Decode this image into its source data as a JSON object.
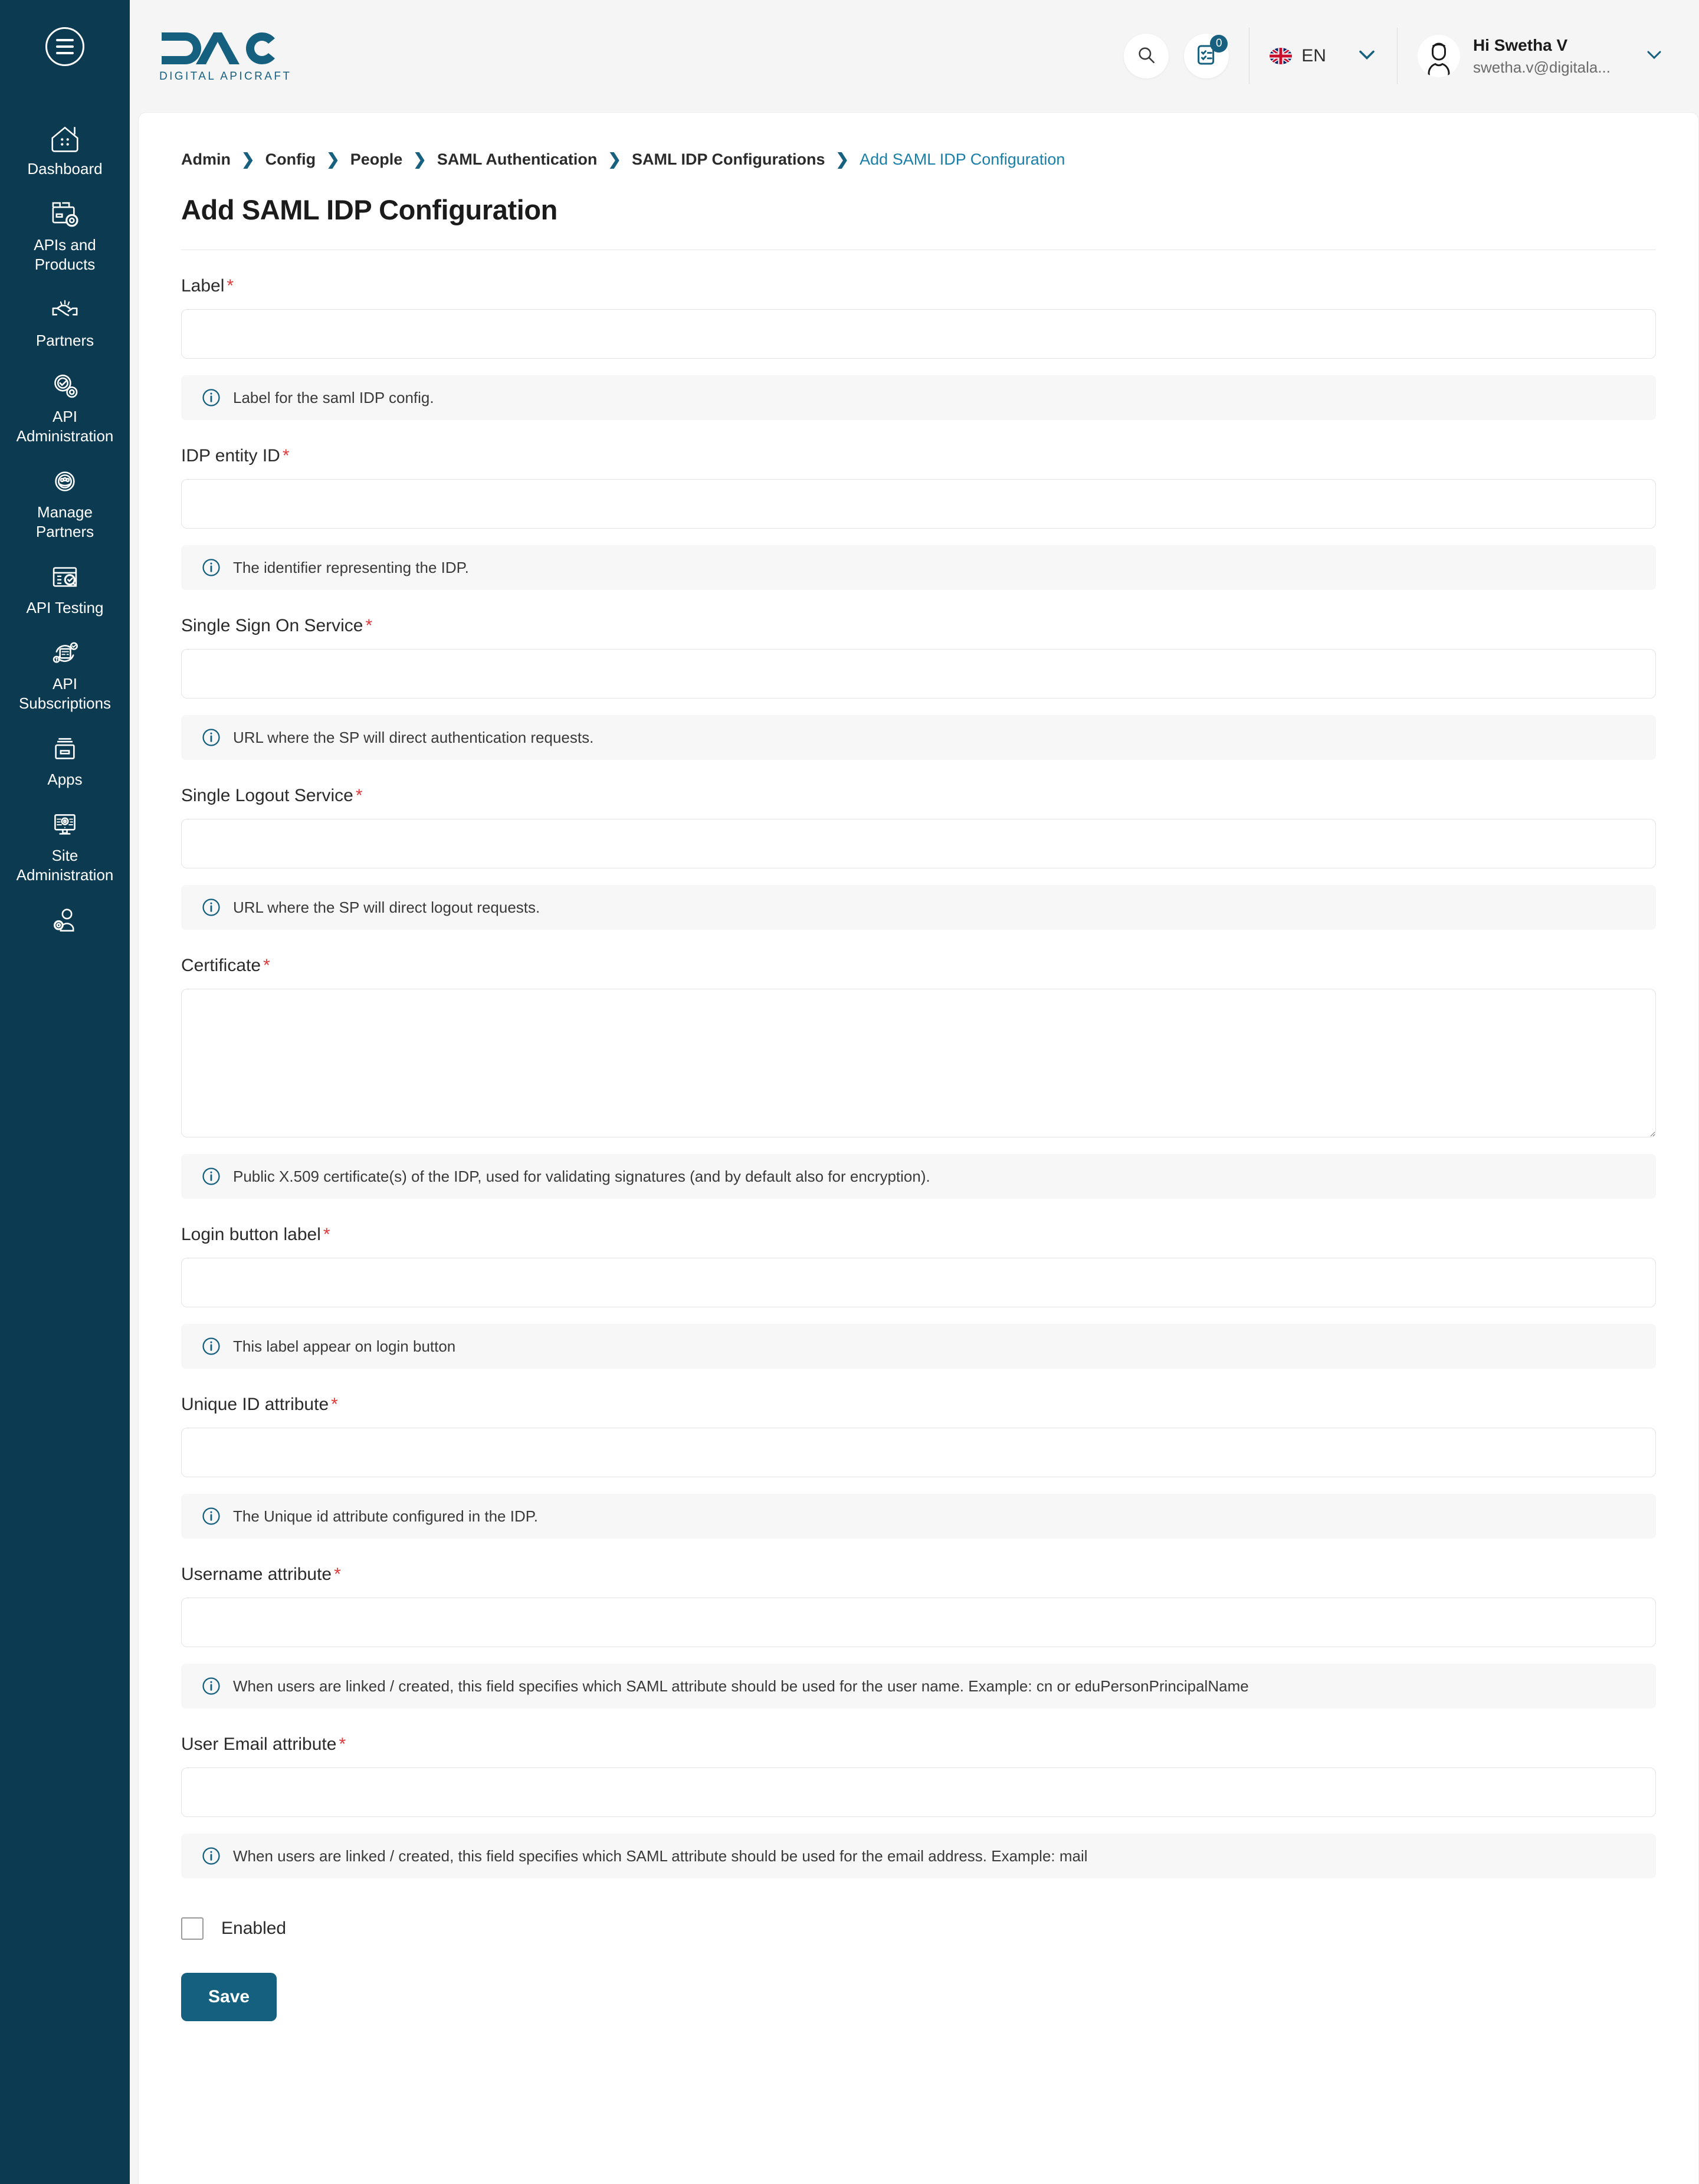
{
  "sidebar": {
    "menu_toggle_label": "menu",
    "items": [
      {
        "label": "Dashboard",
        "icon": "dashboard-home-icon"
      },
      {
        "label": "APIs and Products",
        "icon": "api-products-box-icon"
      },
      {
        "label": "Partners",
        "icon": "handshake-icon"
      },
      {
        "label": "API Administration",
        "icon": "api-admin-gear-icon"
      },
      {
        "label": "Manage Partners",
        "icon": "manage-partners-gear-icon"
      },
      {
        "label": "API Testing",
        "icon": "api-testing-checklist-icon"
      },
      {
        "label": "API Subscriptions",
        "icon": "api-subscriptions-cycle-icon"
      },
      {
        "label": "Apps",
        "icon": "apps-drawer-icon"
      },
      {
        "label": "Site Administration",
        "icon": "site-admin-monitor-icon"
      },
      {
        "label": "",
        "icon": "user-settings-icon"
      }
    ]
  },
  "header": {
    "logo_text": "DAC",
    "logo_tagline": "DIGITAL APICRAFT",
    "search_icon": "search-icon",
    "tasks_icon": "tasks-clipboard-icon",
    "tasks_badge": "0",
    "language_code": "EN",
    "language_flag": "uk-flag-icon",
    "language_chevron": "chevron-down-icon",
    "user_greeting": "Hi Swetha V",
    "user_email": "swetha.v@digitala...",
    "user_chevron": "chevron-down-icon",
    "avatar_icon": "avatar-icon"
  },
  "breadcrumb": [
    {
      "label": "Admin",
      "current": false
    },
    {
      "label": "Config",
      "current": false
    },
    {
      "label": "People",
      "current": false
    },
    {
      "label": "SAML Authentication",
      "current": false
    },
    {
      "label": "SAML IDP Configurations",
      "current": false
    },
    {
      "label": "Add SAML IDP Configuration",
      "current": true
    }
  ],
  "page": {
    "title": "Add SAML IDP Configuration"
  },
  "form": {
    "fields": [
      {
        "name": "label",
        "label": "Label",
        "required": true,
        "type": "text",
        "value": "",
        "placeholder": "",
        "hint": "Label for the saml IDP config."
      },
      {
        "name": "idp-entity-id",
        "label": "IDP entity ID",
        "required": true,
        "type": "text",
        "value": "",
        "placeholder": "",
        "hint": "The identifier representing the IDP."
      },
      {
        "name": "single-sign-on-service",
        "label": "Single Sign On Service",
        "required": true,
        "type": "text",
        "value": "",
        "placeholder": "",
        "hint": "URL where the SP will direct authentication requests."
      },
      {
        "name": "single-logout-service",
        "label": "Single Logout Service",
        "required": true,
        "type": "text",
        "value": "",
        "placeholder": "",
        "hint": "URL where the SP will direct logout requests."
      },
      {
        "name": "certificate",
        "label": "Certificate",
        "required": true,
        "type": "textarea",
        "value": "",
        "placeholder": "",
        "hint": "Public X.509 certificate(s) of the IDP, used for validating signatures (and by default also for encryption)."
      },
      {
        "name": "login-button-label",
        "label": "Login button label",
        "required": true,
        "type": "text",
        "value": "",
        "placeholder": "",
        "hint": "This label appear on login button"
      },
      {
        "name": "unique-id-attribute",
        "label": "Unique ID attribute",
        "required": true,
        "type": "text",
        "value": "",
        "placeholder": "",
        "hint": "The Unique id attribute configured in the IDP."
      },
      {
        "name": "username-attribute",
        "label": "Username attribute",
        "required": true,
        "type": "text",
        "value": "",
        "placeholder": "",
        "hint": "When users are linked / created, this field specifies which SAML attribute should be used for the user name. Example: cn or eduPersonPrincipalName"
      },
      {
        "name": "user-email-attribute",
        "label": "User Email attribute",
        "required": true,
        "type": "text",
        "value": "",
        "placeholder": "",
        "hint": "When users are linked / created, this field specifies which SAML attribute should be used for the email address. Example: mail"
      }
    ],
    "enabled_checkbox": {
      "label": "Enabled",
      "checked": false
    },
    "save_label": "Save"
  },
  "colors": {
    "sidebar_bg": "#0b3a51",
    "accent": "#16607f",
    "link": "#1a7fa8",
    "required_star": "#e03a3a",
    "page_bg": "#f5f5f5",
    "hint_bg": "#f7f7f7"
  }
}
